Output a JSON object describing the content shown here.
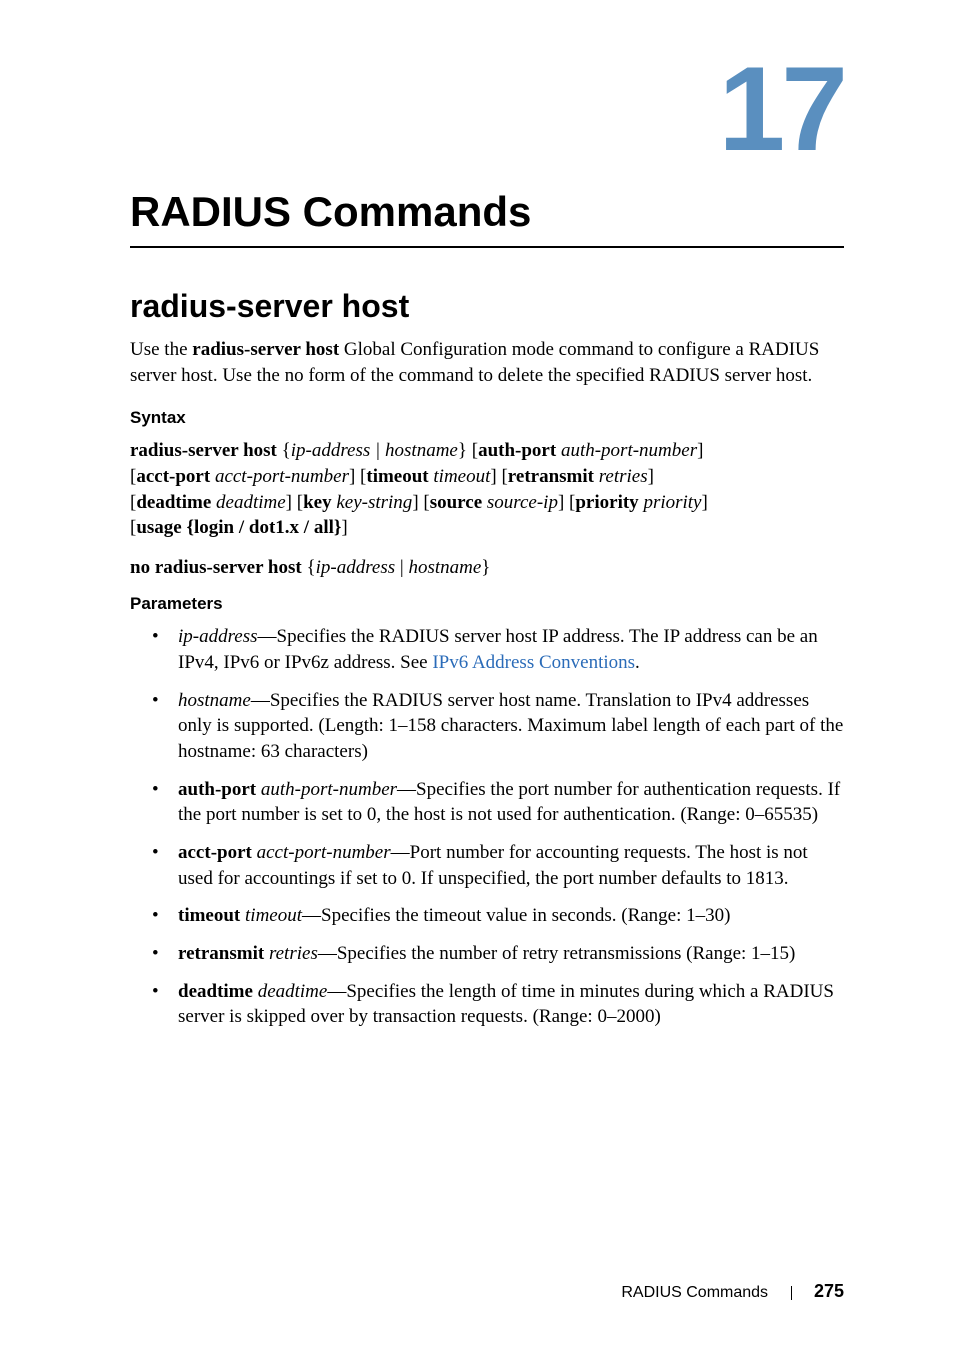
{
  "chapter": {
    "number": "17",
    "title": "RADIUS Commands"
  },
  "section": {
    "title": "radius-server host",
    "intro": "Use the radius-server host Global Configuration mode command to configure a RADIUS server host. Use the no form of the command to delete the specified RADIUS server host."
  },
  "syntax": {
    "heading": "Syntax",
    "line1_parts": {
      "cmd": "radius-server host",
      "brace_open": " {",
      "ip": "ip-address",
      "pipe1": " | ",
      "hostname": "hostname",
      "brace_close": "}",
      "bracket_open1": " [",
      "authport": "auth-port ",
      "authportnum": "auth-port-number",
      "bracket_close1": "]"
    },
    "line2_parts": {
      "b1o": "[",
      "acctport": "acct-port ",
      "acctportnum": "acct-port-number",
      "b1c": "]",
      "b2o": " [",
      "timeout": "timeout ",
      "timeoutval": "timeout",
      "b2c": "]",
      "b3o": " [",
      "retransmit": "retransmit ",
      "retries": "retries",
      "b3c": "]"
    },
    "line3_parts": {
      "b1o": "[",
      "deadtime": "deadtime ",
      "deadtimeval": "deadtime",
      "b1c": "]",
      "b2o": " [",
      "key": "key ",
      "keystring": "key-string",
      "b2c": "]",
      "b3o": " [",
      "source": "source ",
      "sourceip": "source-ip",
      "b3c": "]",
      "b4o": " [",
      "priority": "priority ",
      "priorityval": "priority",
      "b4c": "]"
    },
    "line4_parts": {
      "b1o": "[",
      "usage": "usage ",
      "brace_open": "{",
      "login": "login ",
      "pipe1": "/ ",
      "dot1x": "dot1.x ",
      "pipe2": "/ ",
      "all": "all",
      "brace_close": "}",
      "b1c": "]"
    },
    "noline_parts": {
      "cmd": "no radius-server host",
      "brace_open": " {",
      "ip": "ip-address",
      "pipe": " | ",
      "hostname": " hostname",
      "brace_close": "}"
    }
  },
  "parameters": {
    "heading": "Parameters",
    "items": [
      {
        "term_italic": "ip-address",
        "dash": "—",
        "desc": "Specifies the RADIUS server host IP address. The IP address can be an IPv4, IPv6 or IPv6z address. See ",
        "link": "IPv6 Address Conventions",
        "tail": "."
      },
      {
        "term_italic": "hostname",
        "dash": "—",
        "desc": "Specifies the RADIUS server host name. Translation to IPv4 addresses only is supported. (Length: 1–158 characters. Maximum label length of each part of the hostname: 63 characters)"
      },
      {
        "term_bold": "auth-port ",
        "term_italic": "auth-port-number",
        "dash": "—",
        "desc": "Specifies the port number for authentication requests. If the port number is set to 0, the host is not used for authentication. (Range: 0–65535)"
      },
      {
        "term_bold": "acct-port ",
        "term_italic": "acct-port-number",
        "dash": "—",
        "desc": "Port number for accounting requests. The host is not used for accountings if set to 0. If unspecified, the port number defaults to 1813."
      },
      {
        "term_bold": "timeout ",
        "term_italic": "timeout",
        "dash": "—",
        "desc": "Specifies the timeout value in seconds. (Range: 1–30)"
      },
      {
        "term_bold": "retransmit ",
        "term_italic": "retries",
        "dash": "—",
        "desc": "Specifies the number of retry retransmissions (Range: 1–15)"
      },
      {
        "term_bold": "deadtime ",
        "term_italic": "deadtime",
        "dash": "—",
        "desc": "Specifies the length of time in minutes during which a RADIUS server is skipped over by transaction requests. (Range: 0–2000)"
      }
    ]
  },
  "footer": {
    "section": "RADIUS Commands",
    "page": "275"
  }
}
